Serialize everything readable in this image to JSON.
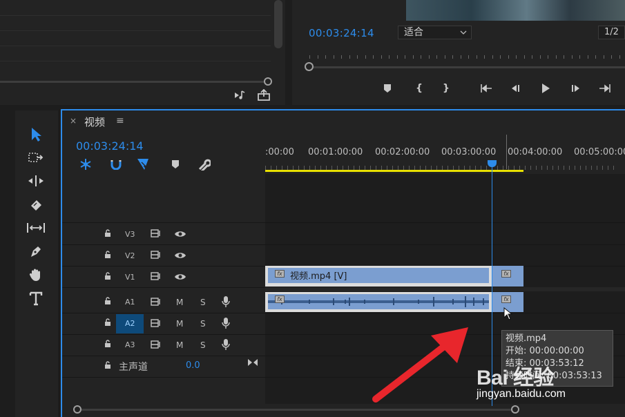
{
  "source_panel": {
    "icons": [
      "music-note-icon",
      "export-frame-icon"
    ]
  },
  "program_monitor": {
    "timecode": "00:03:24:14",
    "fit_value": "适合",
    "resolution_value": "1/2",
    "transport_icons": [
      "add-marker-icon",
      "mark-in-icon",
      "mark-out-icon",
      "go-to-in-icon",
      "step-back-icon",
      "play-icon",
      "step-forward-icon",
      "go-to-out-icon"
    ]
  },
  "tools": [
    "selection-tool-icon",
    "track-select-tool-icon",
    "ripple-edit-tool-icon",
    "razor-tool-icon",
    "slip-tool-icon",
    "pen-tool-icon",
    "hand-tool-icon",
    "type-tool-icon"
  ],
  "timeline": {
    "close": "×",
    "title": "视频",
    "menu": "≡",
    "timecode": "00:03:24:14",
    "ruler_labels": [
      ":00:00",
      "00:01:00:00",
      "00:02:00:00",
      "00:03:00:00",
      "00:04:00:00",
      "00:05:00:00"
    ],
    "tracks": {
      "v3": "V3",
      "v2": "V2",
      "v1": "V1",
      "a1": "A1",
      "a2": "A2",
      "a3": "A3",
      "mute": "M",
      "solo": "S",
      "master_label": "主声道",
      "master_value": "0.0"
    },
    "clip_v1_label": "视频.mp4 [V]",
    "fx": "fx"
  },
  "tooltip": {
    "name": "视频.mp4",
    "start": "开始: 00:00:00:00",
    "end": "结束: 00:03:53:12",
    "duration": "持续时间: 00:03:53:13"
  },
  "watermark": {
    "logo": "Bai 经验",
    "url": "jingyan.baidu.com"
  },
  "colors": {
    "accent": "#2d8ceb",
    "clip": "#7b9ed0",
    "workarea": "#e8e000",
    "arrow": "#e8262c"
  }
}
